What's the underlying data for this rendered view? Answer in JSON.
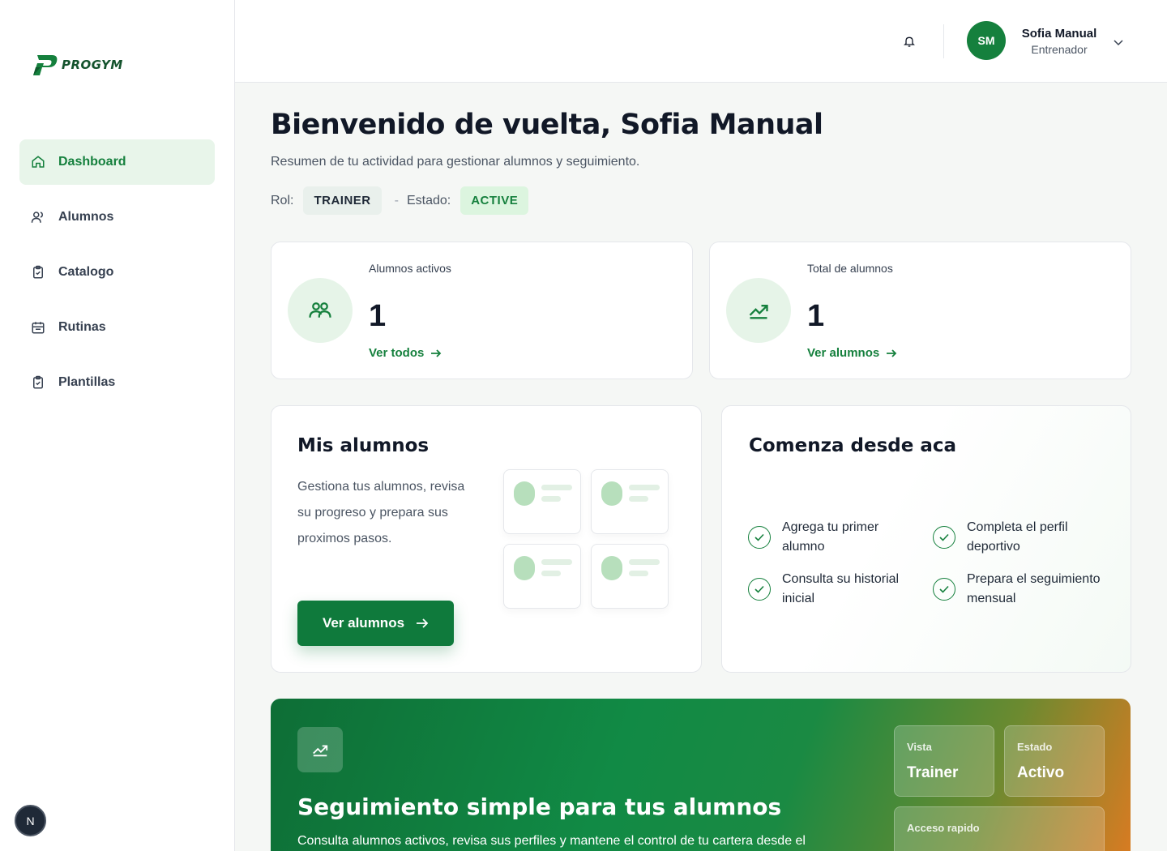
{
  "brand": {
    "name": "PROGYM"
  },
  "sidebar": {
    "items": [
      {
        "label": "Dashboard",
        "icon": "home-icon",
        "active": true
      },
      {
        "label": "Alumnos",
        "icon": "users-icon",
        "active": false
      },
      {
        "label": "Catalogo",
        "icon": "clipboard-check-icon",
        "active": false
      },
      {
        "label": "Rutinas",
        "icon": "calendar-icon",
        "active": false
      },
      {
        "label": "Plantillas",
        "icon": "clipboard-check-icon",
        "active": false
      }
    ],
    "dev_badge": "N"
  },
  "header": {
    "user": {
      "initials": "SM",
      "name": "Sofia Manual",
      "role": "Entrenador"
    }
  },
  "main": {
    "title": "Bienvenido de vuelta, Sofia Manual",
    "subtitle": "Resumen de tu actividad para gestionar alumnos y seguimiento.",
    "role_label": "Rol:",
    "role_value": "TRAINER",
    "separator": "-",
    "status_label": "Estado:",
    "status_value": "ACTIVE",
    "stats": [
      {
        "label": "Alumnos activos",
        "value": "1",
        "link": "Ver todos",
        "icon": "users-icon"
      },
      {
        "label": "Total de alumnos",
        "value": "1",
        "link": "Ver alumnos",
        "icon": "trending-up-icon"
      }
    ],
    "students_card": {
      "title": "Mis alumnos",
      "description": "Gestiona tus alumnos, revisa su progreso y prepara sus proximos pasos.",
      "button": "Ver alumnos"
    },
    "start_card": {
      "title": "Comenza desde aca",
      "items": [
        "Agrega tu primer alumno",
        "Completa el perfil deportivo",
        "Consulta su historial inicial",
        "Prepara el seguimiento mensual"
      ]
    },
    "banner": {
      "title": "Seguimiento simple para tus alumnos",
      "description": "Consulta alumnos activos, revisa sus perfiles y mantene el control de tu cartera desde el",
      "tiles": [
        {
          "label": "Vista",
          "value": "Trainer"
        },
        {
          "label": "Estado",
          "value": "Activo"
        },
        {
          "label": "Acceso rapido",
          "value": ""
        }
      ]
    }
  },
  "colors": {
    "accent": "#15803d",
    "accent_dark": "#0f7a3c",
    "accent_light": "#e6f4e8",
    "banner_end": "#d97b22"
  }
}
